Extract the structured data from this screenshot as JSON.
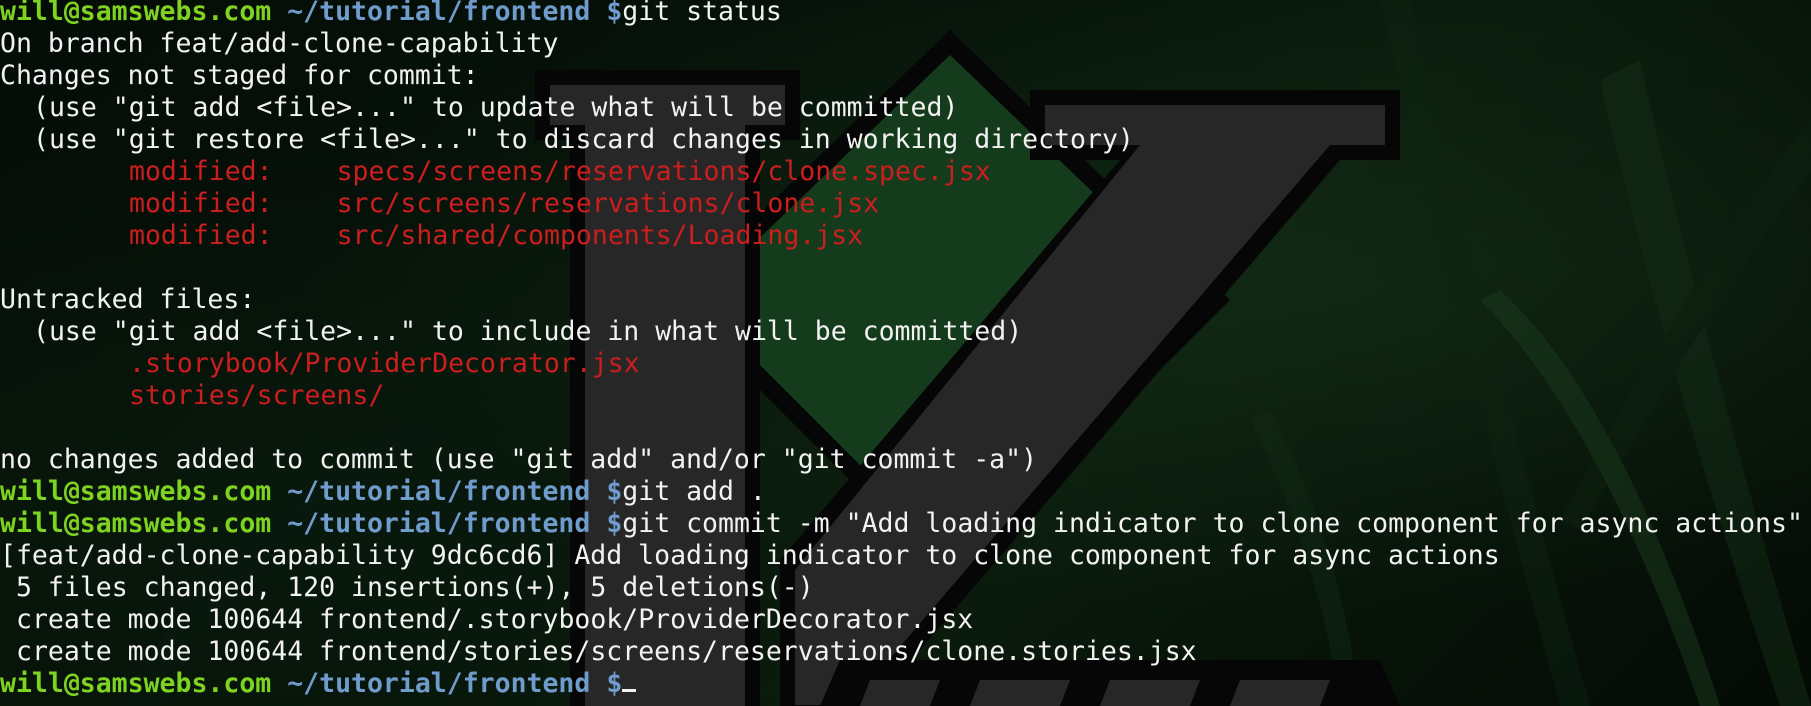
{
  "prompt": {
    "user": "will@samswebs.com",
    "path": "~/tutorial/frontend",
    "symbol": "$"
  },
  "commands": {
    "status": "git status",
    "add": "git add .",
    "commit": "git commit -m \"Add loading indicator to clone component for async actions\""
  },
  "status_output": {
    "branch": "On branch feat/add-clone-capability",
    "not_staged_header": "Changes not staged for commit:",
    "hint_add": "(use \"git add <file>...\" to update what will be committed)",
    "hint_restore": "(use \"git restore <file>...\" to discard changes in working directory)",
    "modified_label": "modified:",
    "modified_files": [
      "specs/screens/reservations/clone.spec.jsx",
      "src/screens/reservations/clone.jsx",
      "src/shared/components/Loading.jsx"
    ],
    "untracked_header": "Untracked files:",
    "hint_include": "(use \"git add <file>...\" to include in what will be committed)",
    "untracked_files": [
      ".storybook/ProviderDecorator.jsx",
      "stories/screens/"
    ],
    "no_changes": "no changes added to commit (use \"git add\" and/or \"git commit -a\")"
  },
  "commit_output": {
    "summary": "[feat/add-clone-capability 9dc6cd6] Add loading indicator to clone component for async actions",
    "stats": "5 files changed, 120 insertions(+), 5 deletions(-)",
    "creates": [
      "create mode 100644 frontend/.storybook/ProviderDecorator.jsx",
      "create mode 100644 frontend/stories/screens/reservations/clone.stories.jsx"
    ]
  },
  "wallpaper": {
    "logo_name": "vim-logo",
    "colors": {
      "logo_green": "#1f5c2c",
      "logo_gray": "#3d3d3d",
      "logo_outline": "#0a0a0a",
      "user": "#7ed321",
      "path": "#6f9ccc",
      "text": "#f2f2f2",
      "error": "#cc1e1e"
    }
  }
}
